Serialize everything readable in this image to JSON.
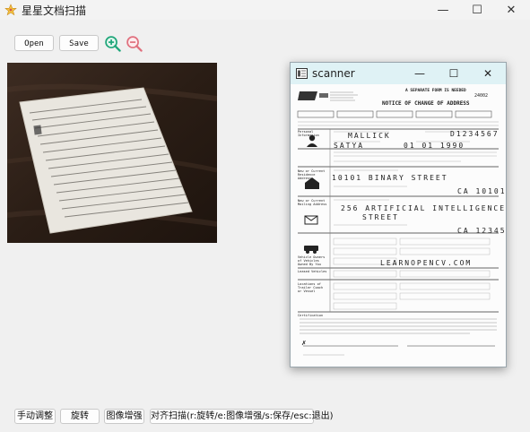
{
  "window": {
    "title": "星星文档扫描",
    "minimize": "—",
    "maximize": "☐",
    "close": "✕"
  },
  "toolbar": {
    "open_label": "Open",
    "save_label": "Save",
    "zoom_in_icon": "zoom-in-icon",
    "zoom_out_icon": "zoom-out-icon"
  },
  "scanner": {
    "title": "scanner",
    "minimize": "—",
    "maximize": "☐",
    "close": "✕",
    "document": {
      "header_right": "A SEPARATE FORM IS NEEDED",
      "heading": "NOTICE OF CHANGE OF ADDRESS",
      "form_code": "24002",
      "sections": {
        "personal": "Personal Information",
        "new_address": "New or Current Residence Address",
        "mailing": "New or Current Mailing Address",
        "vehicle": "Vehicle Owners of Vehicles Owned By You",
        "leased": "Leased Vehicles",
        "boats": "Locations of Trailer Coach or Vessel",
        "certification": "Certification"
      },
      "handwritten": {
        "last_name": "MALLICK",
        "id_number": "D1234567",
        "first_name": "SATYA",
        "birth_date": "01 01 1990",
        "street": "10101 BINARY STREET",
        "city_state_zip": "CA 10101",
        "mailing_street": "256 ARTIFICIAL INTELLIGENCE",
        "mailing_street2": "STREET",
        "mailing_zip": "CA 12345",
        "website": "LEARNOPENCV.COM"
      }
    }
  },
  "bottom_buttons": {
    "manual_adjust": "手动调整",
    "rotate": "旋转",
    "enhance": "图像增强",
    "align_scan": "对齐扫描(r:旋转/e:图像增强/s:保存/esc:退出)"
  }
}
